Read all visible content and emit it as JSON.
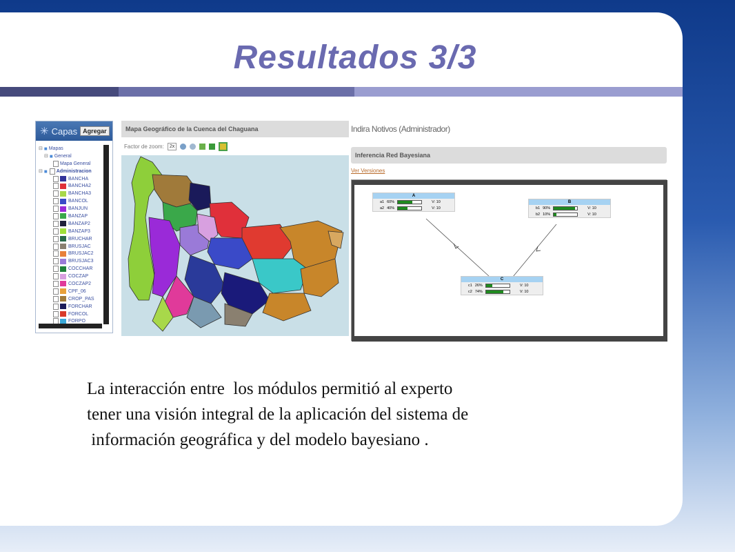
{
  "slide": {
    "title": "Resultados 3/3",
    "lines": [
      "La interacción entre  los módulos permitió al experto",
      "tener una visión integral de la aplicación del sistema de",
      " información geográfica y del modelo bayesiano ."
    ],
    "bar_colors": [
      "#464a7c",
      "#6b6fa8",
      "#9a9dd0"
    ]
  },
  "layers_panel": {
    "title": "Capas",
    "add_button": "Agregar",
    "tree": {
      "root": "Mapas",
      "general": "General",
      "general_child": "Mapa General",
      "admin": "Administracion",
      "layers": [
        {
          "label": "BANCHA",
          "color": "#33339a"
        },
        {
          "label": "BANCHA2",
          "color": "#e0303a"
        },
        {
          "label": "BANCHA3",
          "color": "#a8d84a"
        },
        {
          "label": "BANCOL",
          "color": "#3a4ac8"
        },
        {
          "label": "BANJUN",
          "color": "#9a2ad8"
        },
        {
          "label": "BANZAP",
          "color": "#3aa84a"
        },
        {
          "label": "BANZAP2",
          "color": "#20203a"
        },
        {
          "label": "BANZAP3",
          "color": "#a0e03a"
        },
        {
          "label": "BRUCHAR",
          "color": "#2a6a4a"
        },
        {
          "label": "BRUSJAC",
          "color": "#8a8070"
        },
        {
          "label": "BRUSJAC2",
          "color": "#e8803a"
        },
        {
          "label": "BRUSJAC3",
          "color": "#9a7ad8"
        },
        {
          "label": "COCCHAR",
          "color": "#20803a"
        },
        {
          "label": "COCZAP",
          "color": "#d8a0e0"
        },
        {
          "label": "COCZAP2",
          "color": "#e03a9a"
        },
        {
          "label": "CPF_06",
          "color": "#e8a03a"
        },
        {
          "label": "CROP_PAS",
          "color": "#a07a3a"
        },
        {
          "label": "FORCHAR",
          "color": "#1a1a5a"
        },
        {
          "label": "FORCOL",
          "color": "#d83a2a"
        },
        {
          "label": "FORPO",
          "color": "#3aa8d8"
        }
      ]
    }
  },
  "map_panel": {
    "title": "Mapa Geográfico de la Cuenca del Chaguana",
    "zoom_label": "Factor de zoom:",
    "zoom_value": "2x"
  },
  "bayes_panel": {
    "user": "Indira Notivos (Administrador)",
    "title": "Inferencia Red Bayesiana",
    "versions_link": "Ver Versiones",
    "nodes": [
      {
        "name": "A",
        "rows": [
          {
            "state": "a1",
            "pct": "60%",
            "value": 0.6,
            "v": "V: 10"
          },
          {
            "state": "a2",
            "pct": "40%",
            "value": 0.4,
            "v": "V: 10"
          }
        ]
      },
      {
        "name": "B",
        "rows": [
          {
            "state": "b1",
            "pct": "90%",
            "value": 0.9,
            "v": "V: 10"
          },
          {
            "state": "b2",
            "pct": "10%",
            "value": 0.1,
            "v": "V: 10"
          }
        ]
      },
      {
        "name": "C",
        "rows": [
          {
            "state": "c1",
            "pct": "26%",
            "value": 0.26,
            "v": "V: 10"
          },
          {
            "state": "c2",
            "pct": "74%",
            "value": 0.74,
            "v": "V: 10"
          }
        ]
      }
    ]
  }
}
